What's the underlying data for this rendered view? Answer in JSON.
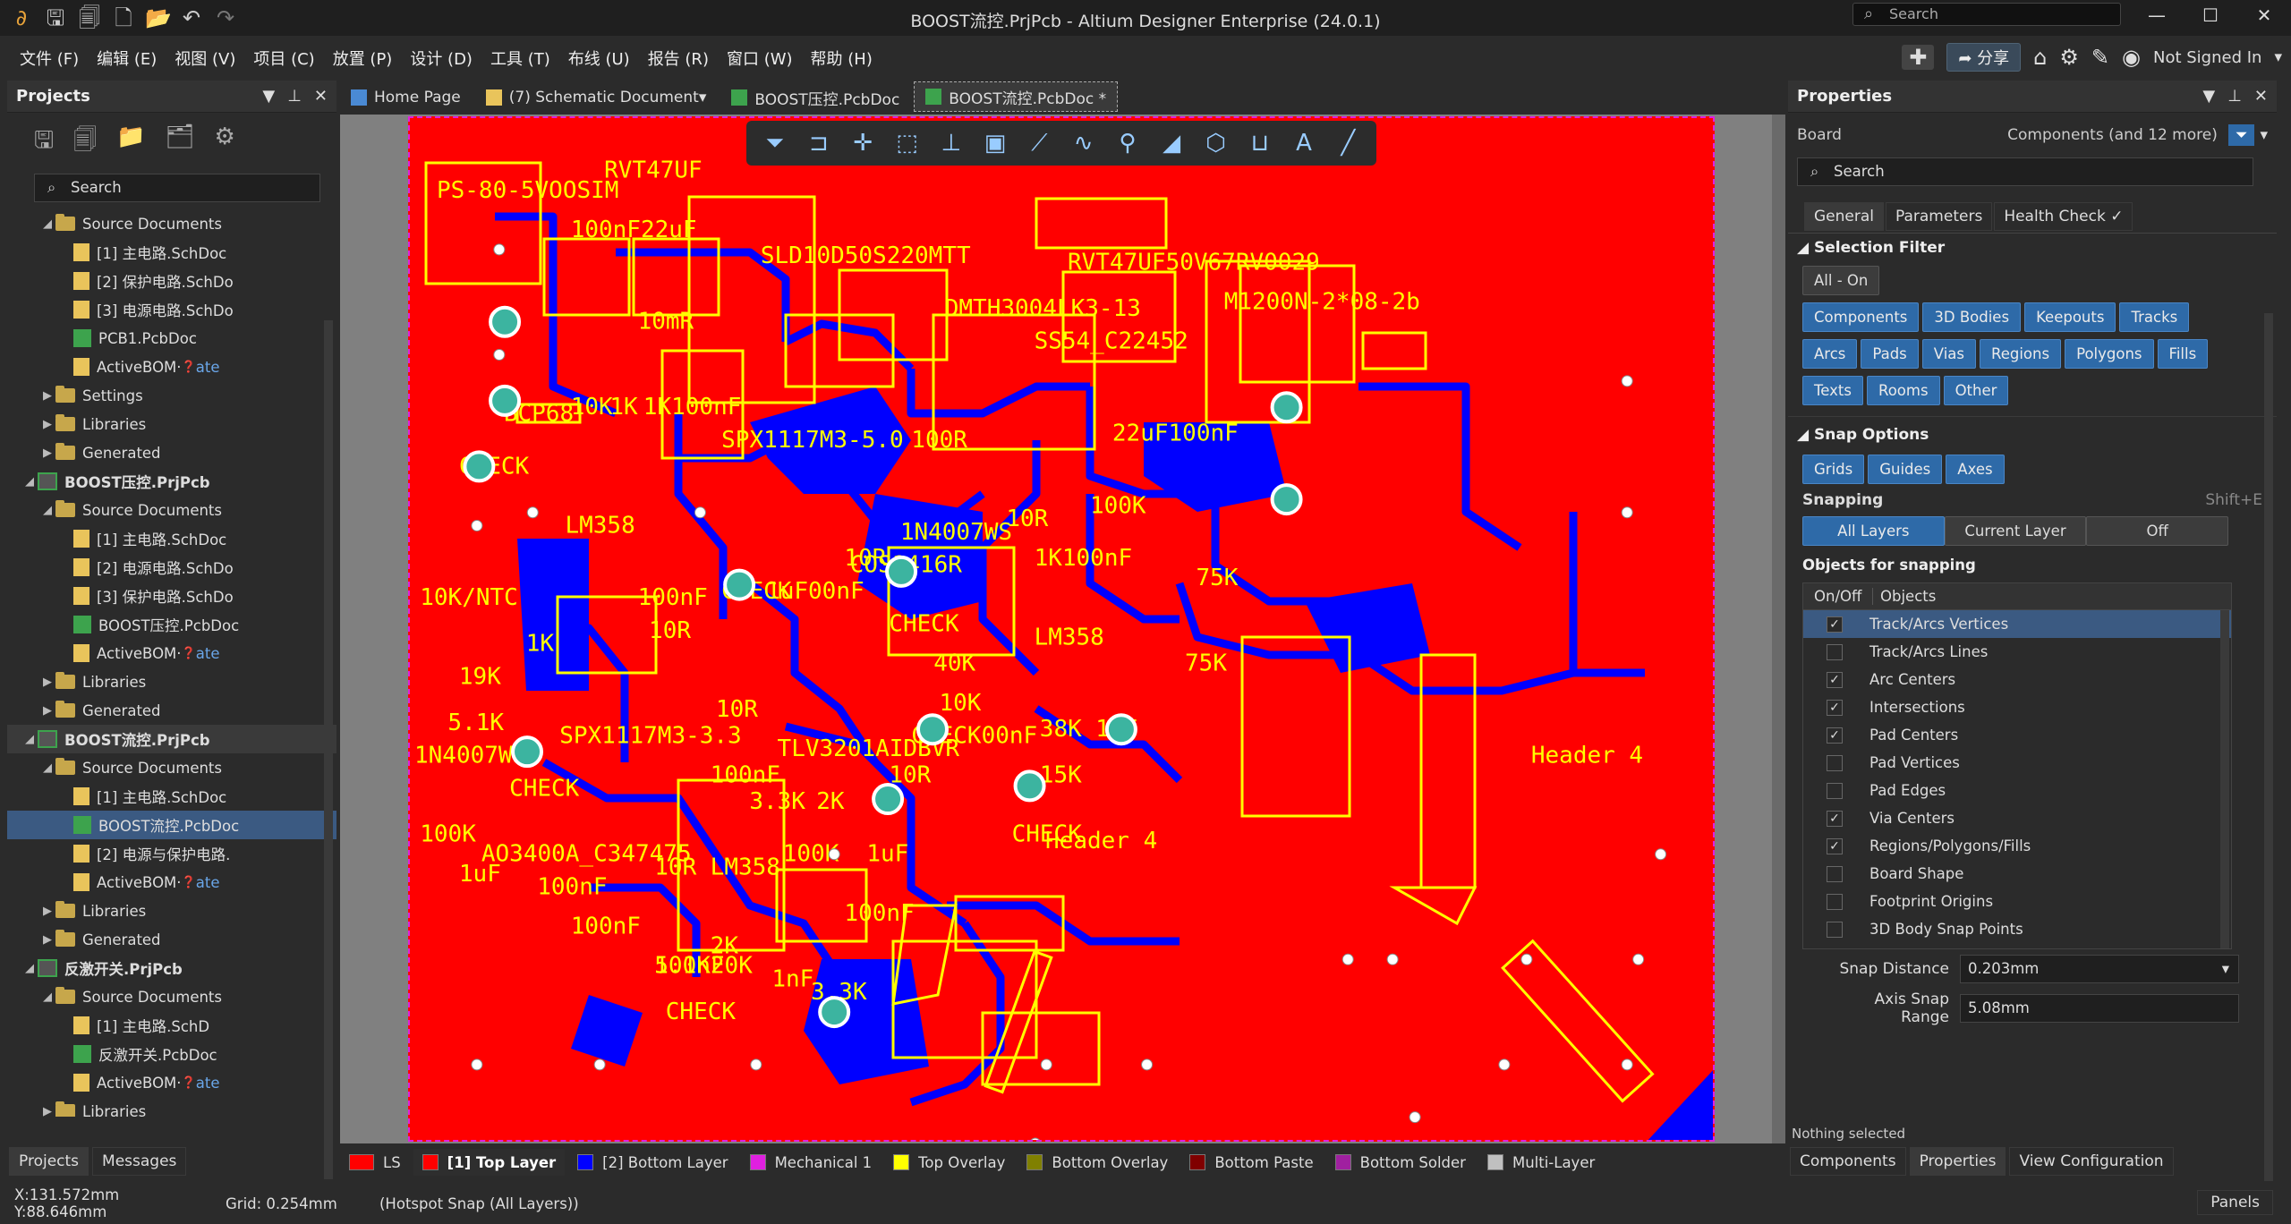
{
  "window": {
    "title": "BOOST流控.PrjPcb - Altium Designer Enterprise (24.0.1)",
    "search_placeholder": "Search"
  },
  "menu": [
    "文件 (F)",
    "编辑 (E)",
    "视图 (V)",
    "项目 (C)",
    "放置 (P)",
    "设计 (D)",
    "工具 (T)",
    "布线 (U)",
    "报告 (R)",
    "窗口 (W)",
    "帮助 (H)"
  ],
  "menu_right": {
    "share": "分享",
    "user": "Not Signed In"
  },
  "projects_panel": {
    "title": "Projects",
    "search_placeholder": "Search",
    "tree": [
      {
        "indent": 1,
        "type": "folder",
        "label": "Source Documents",
        "arrow": "◢"
      },
      {
        "indent": 2,
        "type": "sch",
        "label": "[1] 主电路.SchDoc"
      },
      {
        "indent": 2,
        "type": "sch",
        "label": "[2] 保护电路.SchDo"
      },
      {
        "indent": 2,
        "type": "sch",
        "label": "[3] 电源电路.SchDo"
      },
      {
        "indent": 2,
        "type": "pcb",
        "label": "PCB1.PcbDoc"
      },
      {
        "indent": 2,
        "type": "sch",
        "label": "ActiveBOM·",
        "extra": "ate"
      },
      {
        "indent": 1,
        "type": "folder",
        "label": "Settings",
        "arrow": "▶"
      },
      {
        "indent": 1,
        "type": "folder",
        "label": "Libraries",
        "arrow": "▶"
      },
      {
        "indent": 1,
        "type": "folder",
        "label": "Generated",
        "arrow": "▶"
      },
      {
        "indent": 0,
        "type": "prj",
        "label": "BOOST压控.PrjPcb",
        "arrow": "◢",
        "bold": true
      },
      {
        "indent": 1,
        "type": "folder",
        "label": "Source Documents",
        "arrow": "◢"
      },
      {
        "indent": 2,
        "type": "sch",
        "label": "[1] 主电路.SchDoc"
      },
      {
        "indent": 2,
        "type": "sch",
        "label": "[2] 电源电路.SchDo"
      },
      {
        "indent": 2,
        "type": "sch",
        "label": "[3] 保护电路.SchDo"
      },
      {
        "indent": 2,
        "type": "pcb",
        "label": "BOOST压控.PcbDoc"
      },
      {
        "indent": 2,
        "type": "sch",
        "label": "ActiveBOM·",
        "extra": "ate"
      },
      {
        "indent": 1,
        "type": "folder",
        "label": "Libraries",
        "arrow": "▶"
      },
      {
        "indent": 1,
        "type": "folder",
        "label": "Generated",
        "arrow": "▶"
      },
      {
        "indent": 0,
        "type": "prj",
        "label": "BOOST流控.PrjPcb",
        "arrow": "◢",
        "bold": true,
        "active": true
      },
      {
        "indent": 1,
        "type": "folder",
        "label": "Source Documents",
        "arrow": "◢"
      },
      {
        "indent": 2,
        "type": "sch",
        "label": "[1] 主电路.SchDoc"
      },
      {
        "indent": 2,
        "type": "pcb",
        "label": "BOOST流控.PcbDoc",
        "selected": true
      },
      {
        "indent": 2,
        "type": "sch",
        "label": "[2] 电源与保护电路."
      },
      {
        "indent": 2,
        "type": "sch",
        "label": "ActiveBOM·",
        "extra": "ate"
      },
      {
        "indent": 1,
        "type": "folder",
        "label": "Libraries",
        "arrow": "▶"
      },
      {
        "indent": 1,
        "type": "folder",
        "label": "Generated",
        "arrow": "▶"
      },
      {
        "indent": 0,
        "type": "prj",
        "label": "反激开关.PrjPcb",
        "arrow": "◢",
        "bold": true
      },
      {
        "indent": 1,
        "type": "folder",
        "label": "Source Documents",
        "arrow": "◢"
      },
      {
        "indent": 2,
        "type": "sch",
        "label": "[1] 主电路.SchD"
      },
      {
        "indent": 2,
        "type": "pcb",
        "label": "反激开关.PcbDoc"
      },
      {
        "indent": 2,
        "type": "sch",
        "label": "ActiveBOM·",
        "extra": "ate"
      },
      {
        "indent": 1,
        "type": "folder",
        "label": "Libraries",
        "arrow": "▶"
      }
    ],
    "bottom_tabs": [
      "Projects",
      "Messages"
    ]
  },
  "doc_tabs": [
    {
      "label": "Home Page",
      "icon": "home-icon"
    },
    {
      "label": "(7) Schematic Document",
      "icon": "schematic-icon"
    },
    {
      "label": "BOOST压控.PcbDoc",
      "icon": "pcb-icon"
    },
    {
      "label": "BOOST流控.PcbDoc *",
      "icon": "pcb-icon",
      "active": true
    }
  ],
  "pcb_labels": [
    "RVT47UF",
    "PS-80-5VOOSIM",
    "100nF22uF",
    "10mR",
    "SLD10D50S220MTT",
    "DMTH3004LK3-13",
    "SS54_C22452",
    "RVT47UF50V67RV0029",
    "M1200N-2*08-2b",
    "BCP68",
    "10K",
    "1K",
    "1K100nF",
    "SPX1117M3-5.0",
    "100R",
    "CHECK",
    "LM358",
    "22uF100nF",
    "1N4007WS",
    "10R",
    "10R",
    "COS1416R",
    "1K100nF",
    "100K",
    "10K/NTC",
    "100nF",
    "10R",
    "CHECK",
    "1uF00nF",
    "CHECK",
    "LM358",
    "75K",
    "1K",
    "19K",
    "40K",
    "10K",
    "75K",
    "5.1K",
    "SPX1117M3-3.3",
    "10R",
    "TLV3201AIDBVR",
    "CHECK00nF",
    "38K",
    "1nF",
    "1N4007WS",
    "100nF",
    "CHECK",
    "15K",
    "CHECK",
    "100K",
    "AO3400A_C347475",
    "3.3K",
    "2K",
    "10R",
    "Header 4",
    "Header 4",
    "1uF",
    "100nF",
    "10R",
    "LM358",
    "100K",
    "1uF",
    "100nF",
    "5.1K20K",
    "100nF",
    "100nF",
    "2K",
    "1nF",
    "3.3K",
    "CHECK"
  ],
  "layer_tabs": [
    {
      "label": "LS",
      "color": "#ff0000"
    },
    {
      "label": "[1] Top Layer",
      "color": "#ff0000",
      "active": true
    },
    {
      "label": "[2] Bottom Layer",
      "color": "#0000ff"
    },
    {
      "label": "Mechanical 1",
      "color": "#e020e0"
    },
    {
      "label": "Top Overlay",
      "color": "#ffff00"
    },
    {
      "label": "Bottom Overlay",
      "color": "#808000"
    },
    {
      "label": "Bottom Paste",
      "color": "#800000"
    },
    {
      "label": "Bottom Solder",
      "color": "#a020a0"
    },
    {
      "label": "Multi-Layer",
      "color": "#c0c0c0"
    }
  ],
  "properties": {
    "title": "Properties",
    "board_label": "Board",
    "filter_label": "Components (and 12 more)",
    "search_placeholder": "Search",
    "tabs": [
      "General",
      "Parameters",
      "Health Check ✓"
    ],
    "selection_filter": {
      "title": "Selection Filter",
      "all_on": "All - On",
      "buttons": [
        "Components",
        "3D Bodies",
        "Keepouts",
        "Tracks",
        "Arcs",
        "Pads",
        "Vias",
        "Regions",
        "Polygons",
        "Fills",
        "Texts",
        "Rooms",
        "Other"
      ]
    },
    "snap_options": {
      "title": "Snap Options",
      "buttons": [
        "Grids",
        "Guides",
        "Axes"
      ],
      "snapping_label": "Snapping",
      "snapping_shortcut": "Shift+E",
      "snapping_modes": [
        "All Layers",
        "Current Layer",
        "Off"
      ],
      "objects_title": "Objects for snapping",
      "col_onoff": "On/Off",
      "col_objects": "Objects",
      "objects": [
        {
          "label": "Track/Arcs Vertices",
          "on": true,
          "selected": true
        },
        {
          "label": "Track/Arcs Lines",
          "on": false
        },
        {
          "label": "Arc Centers",
          "on": true
        },
        {
          "label": "Intersections",
          "on": true
        },
        {
          "label": "Pad Centers",
          "on": true
        },
        {
          "label": "Pad Vertices",
          "on": false
        },
        {
          "label": "Pad Edges",
          "on": false
        },
        {
          "label": "Via Centers",
          "on": true
        },
        {
          "label": "Regions/Polygons/Fills",
          "on": true
        },
        {
          "label": "Board Shape",
          "on": false
        },
        {
          "label": "Footprint Origins",
          "on": false
        },
        {
          "label": "3D Body Snap Points",
          "on": false
        }
      ],
      "snap_distance_label": "Snap Distance",
      "snap_distance": "0.203mm",
      "axis_snap_label": "Axis Snap Range",
      "axis_snap": "5.08mm"
    },
    "nothing_selected": "Nothing selected",
    "bottom_tabs": [
      "Components",
      "Properties",
      "View Configuration"
    ]
  },
  "status": {
    "coords": "X:131.572mm Y:88.646mm",
    "grid": "Grid: 0.254mm",
    "snap": "(Hotspot Snap (All Layers))",
    "panels": "Panels"
  }
}
